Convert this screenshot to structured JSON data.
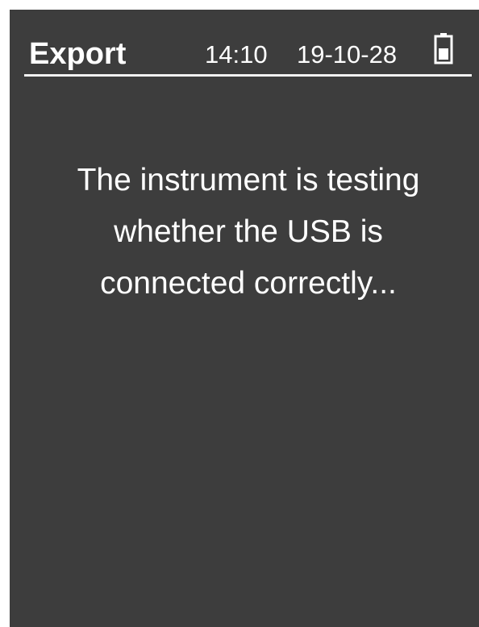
{
  "header": {
    "title": "Export",
    "time": "14:10",
    "date": "19-10-28",
    "battery_icon": "battery-icon"
  },
  "message": {
    "lines": [
      "The instrument is testing",
      "whether the USB is",
      "connected correctly..."
    ]
  },
  "colors": {
    "screen_background": "#3d3d3d",
    "text": "#ffffff",
    "page_background": "#ffffff"
  }
}
